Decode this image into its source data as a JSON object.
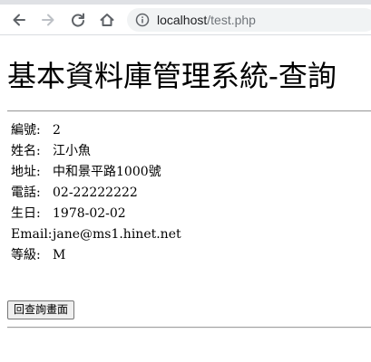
{
  "browser": {
    "url_host": "localhost",
    "url_path": "/test.php",
    "icons": [
      "back-icon",
      "forward-icon",
      "reload-icon",
      "home-icon",
      "info-icon"
    ]
  },
  "page": {
    "title": "基本資料庫管理系統-查詢",
    "fields": [
      {
        "label": "編號:",
        "value": "2"
      },
      {
        "label": "姓名:",
        "value": "江小魚"
      },
      {
        "label": "地址:",
        "value": "中和景平路1000號"
      },
      {
        "label": "電話:",
        "value": "02-22222222"
      },
      {
        "label": "生日:",
        "value": "1978-02-02"
      },
      {
        "label": "Email:",
        "value": "jane@ms1.hinet.net"
      },
      {
        "label": "等級:",
        "value": "M"
      }
    ],
    "back_button_label": "回查詢畫面"
  }
}
